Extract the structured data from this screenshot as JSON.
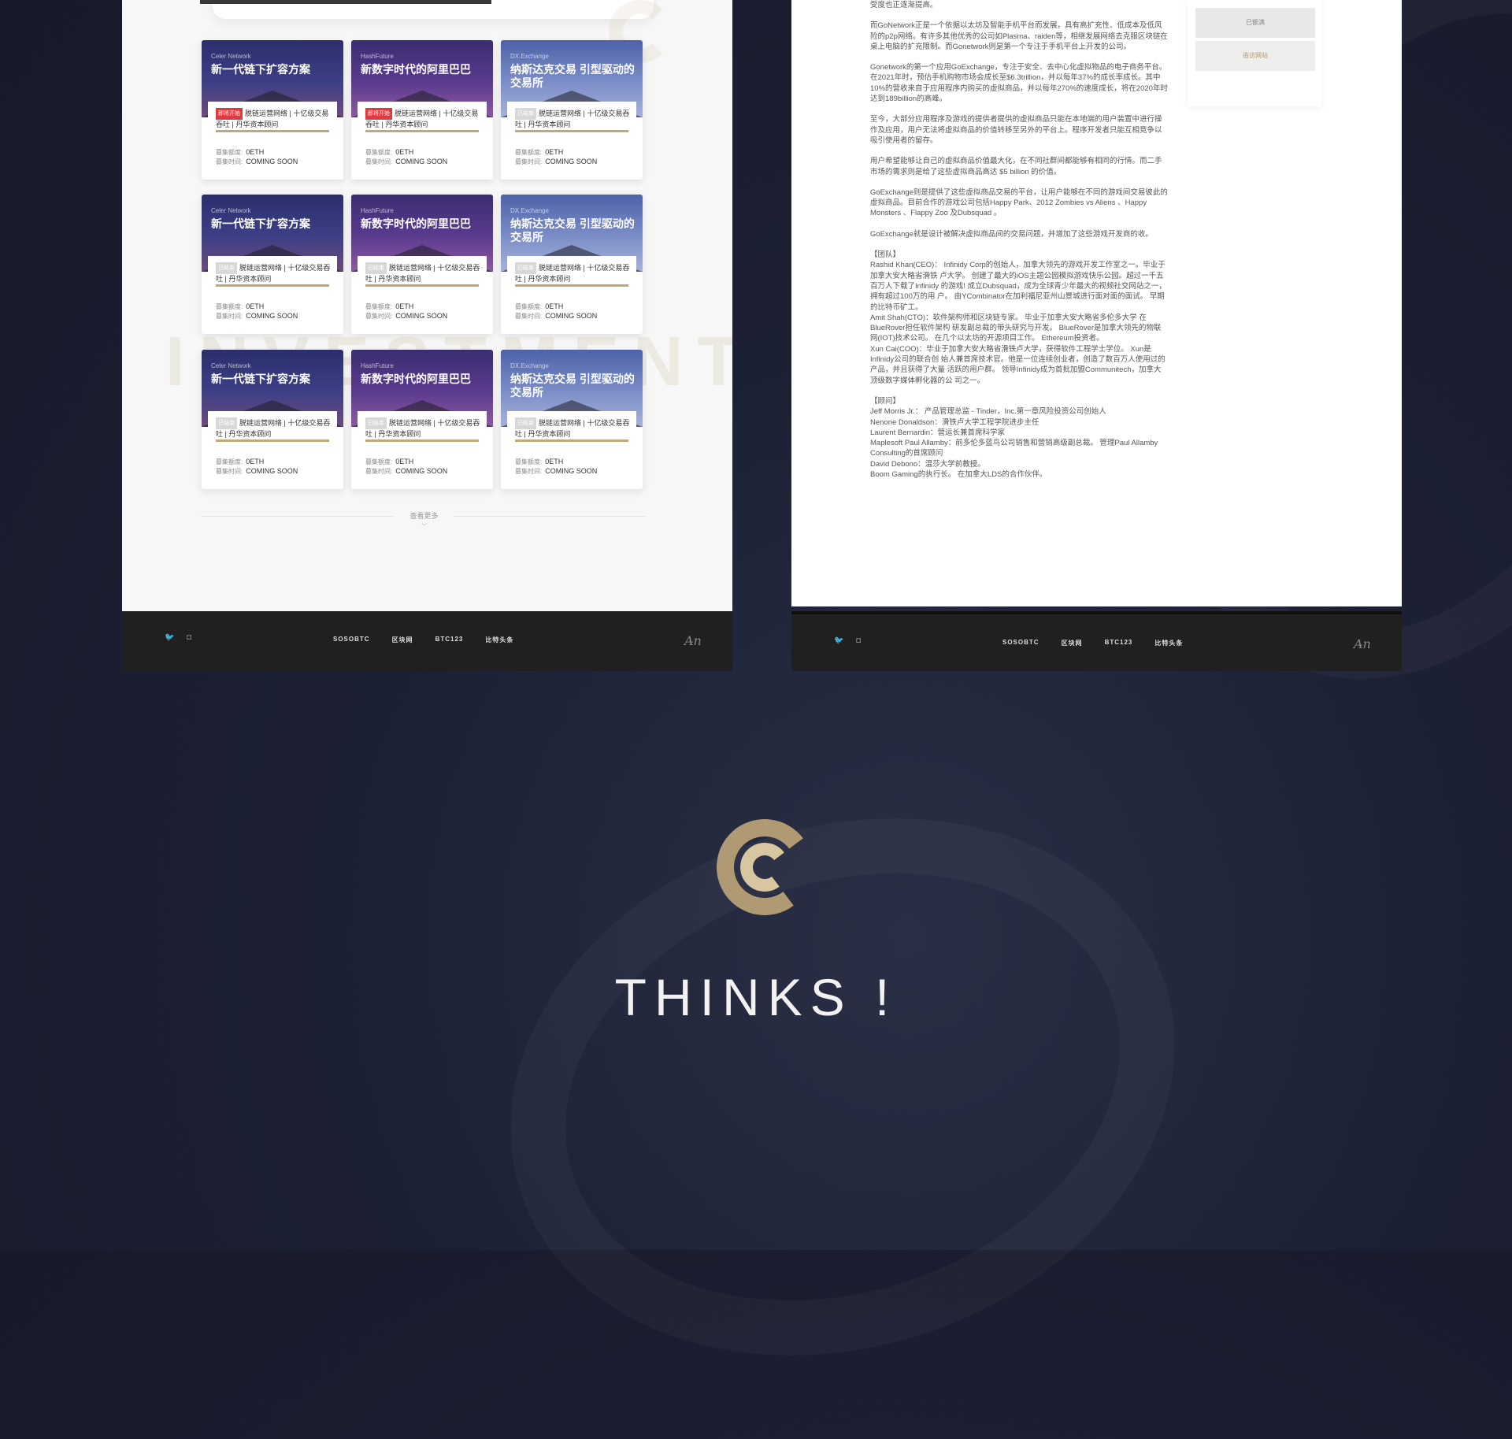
{
  "left_page": {
    "watermark": "INVESTMENT",
    "cards": [
      {
        "source": "Celer Network",
        "title": "新一代链下扩容方案",
        "badge": "即将开始",
        "badge_type": "hot",
        "desc": "脱链运营网络 | 十亿级交易吞吐 | 丹华资本顾问",
        "raise_label": "募集额度:",
        "raise_value": "0ETH",
        "time_label": "募集时间:",
        "time_value": "COMING SOON"
      },
      {
        "source": "HashFuture",
        "title": "新数字时代的阿里巴巴",
        "badge": "即将开始",
        "badge_type": "hot",
        "desc": "脱链运营网络 | 十亿级交易吞吐 | 丹华资本顾问",
        "raise_label": "募集额度:",
        "raise_value": "0ETH",
        "time_label": "募集时间:",
        "time_value": "COMING SOON"
      },
      {
        "source": "DX.Exchange",
        "title": "纳斯达克交易 引型驱动的交易所",
        "badge": "已结束",
        "badge_type": "ended",
        "desc": "脱链运营网络 | 十亿级交易吞吐 | 丹华资本顾问",
        "raise_label": "募集额度:",
        "raise_value": "0ETH",
        "time_label": "募集时间:",
        "time_value": "COMING SOON"
      },
      {
        "source": "Celer Network",
        "title": "新一代链下扩容方案",
        "badge": "已结束",
        "badge_type": "ended",
        "desc": "脱链运营网络 | 十亿级交易吞吐 | 丹华资本顾问",
        "raise_label": "募集额度:",
        "raise_value": "0ETH",
        "time_label": "募集时间:",
        "time_value": "COMING SOON"
      },
      {
        "source": "HashFuture",
        "title": "新数字时代的阿里巴巴",
        "badge": "已结束",
        "badge_type": "ended",
        "desc": "脱链运营网络 | 十亿级交易吞吐 | 丹华资本顾问",
        "raise_label": "募集额度:",
        "raise_value": "0ETH",
        "time_label": "募集时间:",
        "time_value": "COMING SOON"
      },
      {
        "source": "DX.Exchange",
        "title": "纳斯达克交易 引型驱动的交易所",
        "badge": "已结束",
        "badge_type": "ended",
        "desc": "脱链运营网络 | 十亿级交易吞吐 | 丹华资本顾问",
        "raise_label": "募集额度:",
        "raise_value": "0ETH",
        "time_label": "募集时间:",
        "time_value": "COMING SOON"
      },
      {
        "source": "Celer Network",
        "title": "新一代链下扩容方案",
        "badge": "已结束",
        "badge_type": "ended",
        "desc": "脱链运营网络 | 十亿级交易吞吐 | 丹华资本顾问",
        "raise_label": "募集额度:",
        "raise_value": "0ETH",
        "time_label": "募集时间:",
        "time_value": "COMING SOON"
      },
      {
        "source": "HashFuture",
        "title": "新数字时代的阿里巴巴",
        "badge": "已结束",
        "badge_type": "ended",
        "desc": "脱链运营网络 | 十亿级交易吞吐 | 丹华资本顾问",
        "raise_label": "募集额度:",
        "raise_value": "0ETH",
        "time_label": "募集时间:",
        "time_value": "COMING SOON"
      },
      {
        "source": "DX.Exchange",
        "title": "纳斯达克交易 引型驱动的交易所",
        "badge": "已结束",
        "badge_type": "ended",
        "desc": "脱链运营网络 | 十亿级交易吞吐 | 丹华资本顾问",
        "raise_label": "募集额度:",
        "raise_value": "0ETH",
        "time_label": "募集时间:",
        "time_value": "COMING SOON"
      }
    ],
    "progress_fraction": 1.0,
    "more_label": "查看更多",
    "more_arrow": "﹀"
  },
  "right_page": {
    "intro_tail": "受度也正逐渐提高。",
    "paragraphs": [
      "而GoNetwork正是一个依据以太坊及智能手机平台而发展，具有高扩充性、低成本及低风险的p2p网络。有许多其他优秀的公司如Plasma、raiden等，相继发展网络去克服区块链在桌上电脑的扩充限制。而Gonetwork则是第一个专注于手机平台上开发的公司。",
      "Gonetwork的第一个应用GoExchange，专注于安全、去中心化虚拟物品的电子商务平台。在2021年时，预估手机购物市场会成长至$6.3trillion，并以每年37%的成长率成长。其中10%的营收来自于应用程序内购买的虚拟商品，并以每年270%的速度成长，将在2020年时达到189billion的高峰。",
      "至今，大部分应用程序及游戏的提供者提供的虚拟商品只能在本地端的用户装置中进行操作及应用，用户无法将虚拟商品的价值转移至另外的平台上。程序开发者只能互相竞争以吸引使用者的留存。",
      "用户希望能够让自己的虚拟商品价值最大化，在不同社群间都能够有相同的行情。而二手市场的需求则是给了这些虚拟商品高达 $5 billion 的价值。",
      "GoExchange则是提供了这些虚拟商品交易的平台，让用户能够在不同的游戏间交易彼此的虚拟商品。目前合作的游戏公司包括Happy Park、2012 Zombies vs Aliens 、Happy Monsters 、Flappy Zoo 及Dubsquad 。",
      "GoExchange就是设计被解决虚拟商品间的交易问题，并增加了这些游戏开发商的收。"
    ],
    "team_heading": "【团队】",
    "team": [
      " Rashid Khan(CEO)： Infinidy Corp的创始人，加拿大领先的游戏开发工作室之一。毕业于加拿大安大略省滑铁 卢大学。 创建了最大的iOS主题公园模拟游戏快乐公园。超过一千五百万人下载了Infinidy 的游戏! 成立Dubsquad，成为全球青少年最大的视频社交网站之一，拥有超过100万的用 户。   由YCombinator在加利福尼亚州山景城进行面对面的面试。 早期的比特币矿工。",
      " Amit Shah(CTO)：软件架构师和区块链专家。 毕业于加拿大安大略省多伦多大学  在BlueRover担任软件架构 研发副总裁的带头研究与开发。 BlueRover是加拿大领先的物联网(IOT)技术公司。 在几个以太坊的开源项目工作。 Ethereum投资者。",
      " Xun Cai(COO)：毕业于加拿大安大略省滑铁卢大学，获得软件工程学士学位。 Xun是Infinidy公司的联合创 始人兼首席技术官。他是一位连续创业者，创造了数百万人使用过的产品，并且获得了大量 活跃的用户群。 领导Infinidy成为首批加盟Communitech，加拿大顶级数字媒体孵化器的公 司之一。"
    ],
    "advisors_heading": "【顾问】",
    "advisors": [
      " Jeff Morris Jr.： 产品管理总监 - Tinder，Inc.第一章风险投资公司创始人",
      "Nenone Donaldson：滑铁卢大学工程学院进步主任",
      "Laurent Bernardin：营运长兼首席科学家",
      "Maplesoft Paul Allamby：前多伦多蓝鸟公司销售和营销高级副总裁。 管理Paul Allamby Consulting的首席顾问",
      " David Debono：温莎大学前教授。",
      "Boom Gaming的执行长。 在加拿大LDS的合作伙伴。"
    ],
    "side_btn_1": "已额满",
    "side_btn_2": "造访网站"
  },
  "footer": {
    "twitter_icon": "twitter-icon",
    "instagram_icon": "instagram-icon",
    "nav": [
      "SOSOBTC",
      "区块网",
      "BTC123",
      "比特头条"
    ],
    "signature": "A̵n"
  },
  "thanks": {
    "text": "THINKS !"
  },
  "colors": {
    "gold": "#c2a878",
    "hot_badge": "#e0393e",
    "background": "#1c2033"
  }
}
